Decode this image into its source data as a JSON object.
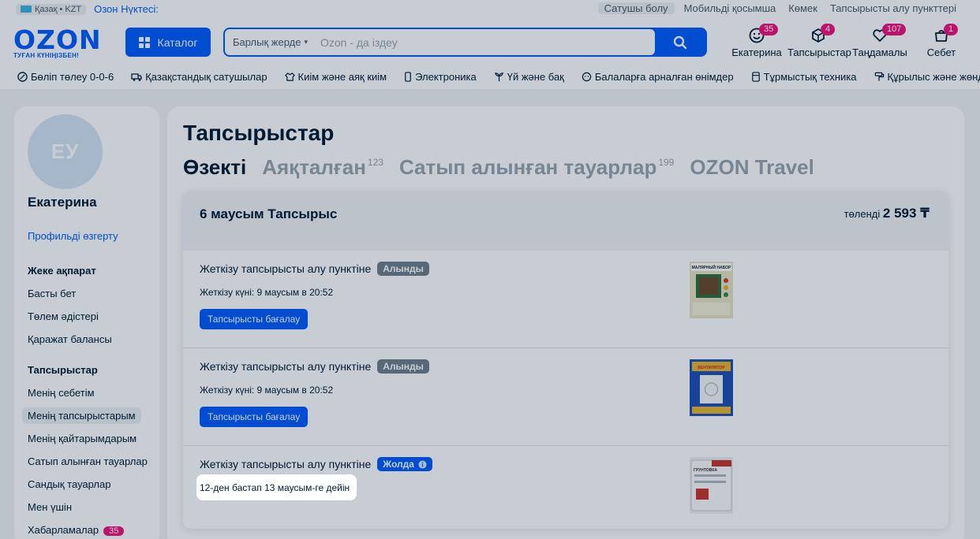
{
  "topbar": {
    "locale": "Қазақ • KZT",
    "ozon_point": "Озон Нүктесі:",
    "links": [
      "Сатушы болу",
      "Мобильді қосымша",
      "Көмек",
      "Тапсырысты алу пункттері"
    ]
  },
  "header": {
    "logo_word": "OZON",
    "logo_tag": "ТУҒАН КҮНІҢІЗБЕН!",
    "catalog_label": "Каталог",
    "search_scope": "Барлық жерде",
    "search_placeholder": "Ozon - да іздеу",
    "icons": [
      {
        "label": "Екатерина",
        "badge": "35",
        "icon": "profile-icon"
      },
      {
        "label": "Тапсырыстар",
        "badge": "4",
        "icon": "box-icon"
      },
      {
        "label": "Таңдамалы",
        "badge": "107",
        "icon": "heart-icon"
      },
      {
        "label": "Себет",
        "badge": "1",
        "icon": "bag-icon"
      }
    ]
  },
  "categories": [
    "Бөліп төлеу 0-0-6",
    "Қазақстандық сатушылар",
    "Киім және аяқ киім",
    "Электроника",
    "Үй және бақ",
    "Балаларға арналған өнімдер",
    "Тұрмыстық техника",
    "Құрылыс және жөндеу"
  ],
  "sidebar": {
    "avatar_initials": "ЕУ",
    "name": "Екатерина",
    "edit_profile": "Профильді өзгерту",
    "section1_title": "Жеке ақпарат",
    "section1_items": [
      "Басты бет",
      "Төлем әдістері",
      "Қаражат балансы"
    ],
    "section2_title": "Тапсырыстар",
    "section2_items": [
      "Менің себетім",
      "Менің тапсырыстарым",
      "Менің қайтарымдарым",
      "Сатып алынған тауарлар",
      "Сандық тауарлар",
      "Мен үшін",
      "Хабарламалар"
    ],
    "notifications_badge": "35"
  },
  "main": {
    "title": "Тапсырыстар",
    "tabs": [
      {
        "label": "Өзекті",
        "count": ""
      },
      {
        "label": "Аяқталған",
        "count": "123"
      },
      {
        "label": "Сатып алынған тауарлар",
        "count": "199"
      },
      {
        "label": "OZON Travel",
        "count": ""
      }
    ],
    "order": {
      "title": "6 маусым Тапсырыс",
      "paid_label": "төленді",
      "paid_amount": "2 593 ₸",
      "shipments": [
        {
          "title": "Жеткізу тапсырысты алу пунктіне",
          "status": "Алынды",
          "date": "Жеткізу күні: 9 маусым в 20:52",
          "button": "Тапсырысты бағалау",
          "product": "МАЛЯРНЫЙ НАБОР"
        },
        {
          "title": "Жеткізу тапсырысты алу пунктіне",
          "status": "Алынды",
          "date": "Жеткізу күні: 9 маусым в 20:52",
          "button": "Тапсырысты бағалау",
          "product": "ВЕНТИЛЯТОР"
        },
        {
          "title": "Жеткізу тапсырысты алу пунктіне",
          "status": "Жолда",
          "date": "12-ден бастап 13 маусым-ге дейін",
          "product": "ГРУНТОВКА"
        }
      ]
    }
  },
  "colors": {
    "brand": "#005bff",
    "badge": "#f1117e",
    "overlay": "#001a34"
  }
}
